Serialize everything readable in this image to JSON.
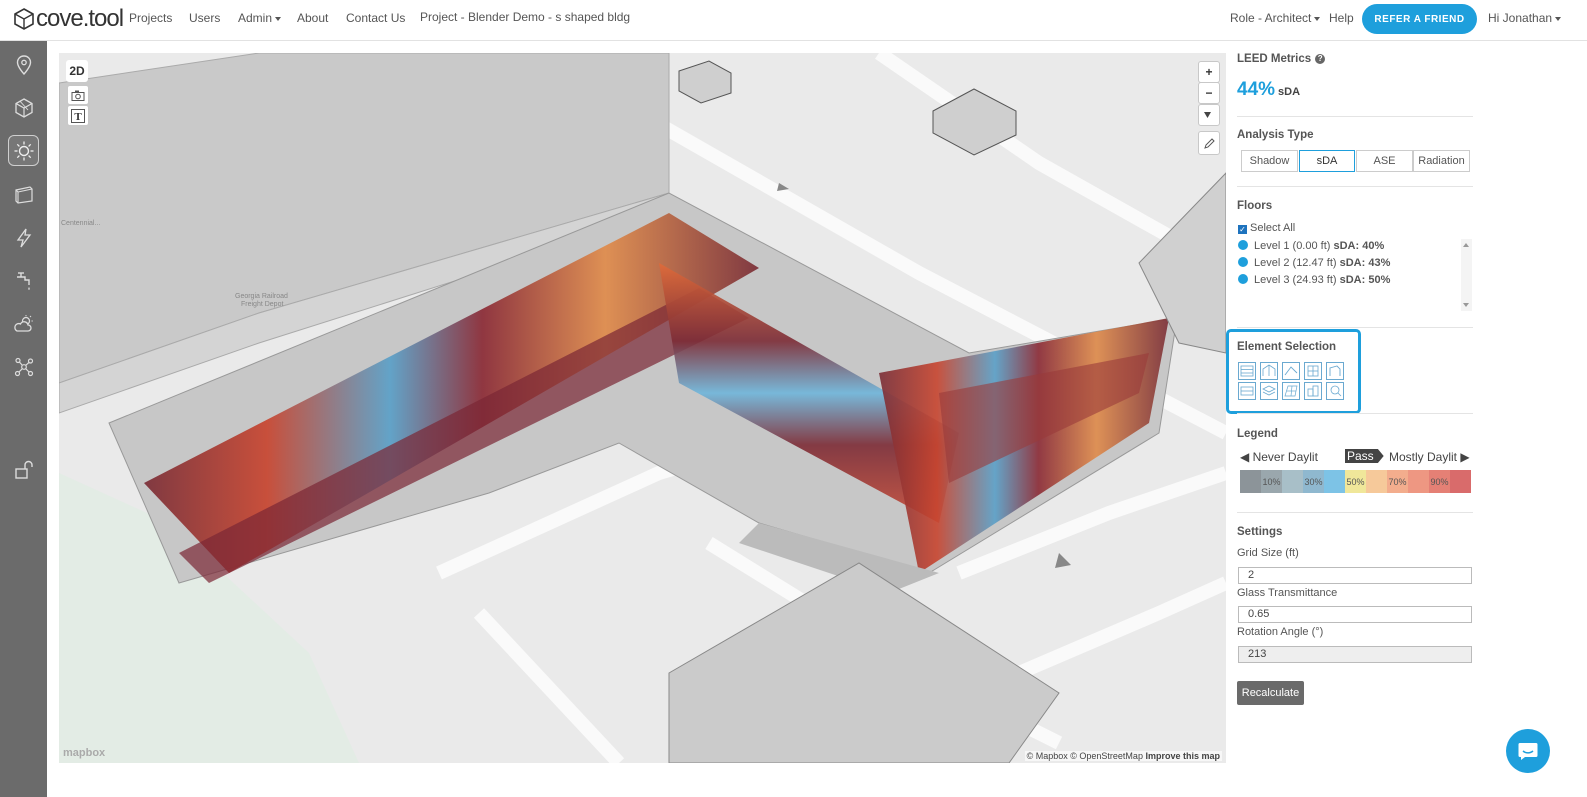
{
  "app": {
    "logo_text": "cove.tool"
  },
  "nav": {
    "projects": "Projects",
    "users": "Users",
    "admin": "Admin",
    "about": "About",
    "contact": "Contact Us",
    "project_title": "Project - Blender Demo - s shaped bldg",
    "role": "Role - Architect",
    "help": "Help",
    "refer": "REFER A FRIEND",
    "user": "Hi Jonathan"
  },
  "sidebar": {
    "items": [
      "location-pin-icon",
      "geometry-cube-icon",
      "sun-daylight-icon",
      "box-3d-icon",
      "lightning-energy-icon",
      "water-faucet-icon",
      "cloud-sun-weather-icon",
      "network-nodes-icon",
      "unlock-icon"
    ],
    "active": "sun-daylight-icon"
  },
  "map": {
    "btn_2d": "2D",
    "zoom_in": "+",
    "zoom_out": "−",
    "attribution_1": "© Mapbox © OpenStreetMap",
    "attribution_2": "Improve this map",
    "mapbox": "mapbox",
    "poi_1": "Georgia Railroad Freight Depot",
    "poi_2": "Centennial..."
  },
  "panel": {
    "leed_title": "LEED Metrics",
    "help_glyph": "?",
    "sda_value": "44%",
    "sda_unit": "sDA",
    "analysis_title": "Analysis Type",
    "tabs": [
      "Shadow",
      "sDA",
      "ASE",
      "Radiation"
    ],
    "active_tab": "sDA",
    "floors_title": "Floors",
    "select_all": "Select All",
    "floors": [
      {
        "label": "Level 1 (0.00 ft)",
        "metric": "sDA: 40%"
      },
      {
        "label": "Level 2 (12.47 ft)",
        "metric": "sDA: 43%"
      },
      {
        "label": "Level 3 (24.93 ft)",
        "metric": "sDA: 50%"
      }
    ],
    "element_title": "Element Selection",
    "legend_title": "Legend",
    "legend_left": "◀ Never Daylit",
    "legend_pass": "Pass",
    "legend_right": "Mostly Daylit ▶",
    "legend_ticks": [
      "",
      "10%",
      "",
      "30%",
      "",
      "50%",
      "",
      "70%",
      "",
      "90%",
      ""
    ],
    "legend_colors": [
      "#8c9499",
      "#9aa7ad",
      "#a8bfc8",
      "#8fb8cf",
      "#7dc3e6",
      "#f0e79a",
      "#f6c99a",
      "#f3ad8d",
      "#ee9782",
      "#e58075",
      "#d96b6b"
    ],
    "settings_title": "Settings",
    "grid_label": "Grid Size (ft)",
    "grid_value": "2",
    "glass_label": "Glass Transmittance",
    "glass_value": "0.65",
    "rotation_label": "Rotation Angle (°)",
    "rotation_value": "213",
    "recalc": "Recalculate"
  }
}
